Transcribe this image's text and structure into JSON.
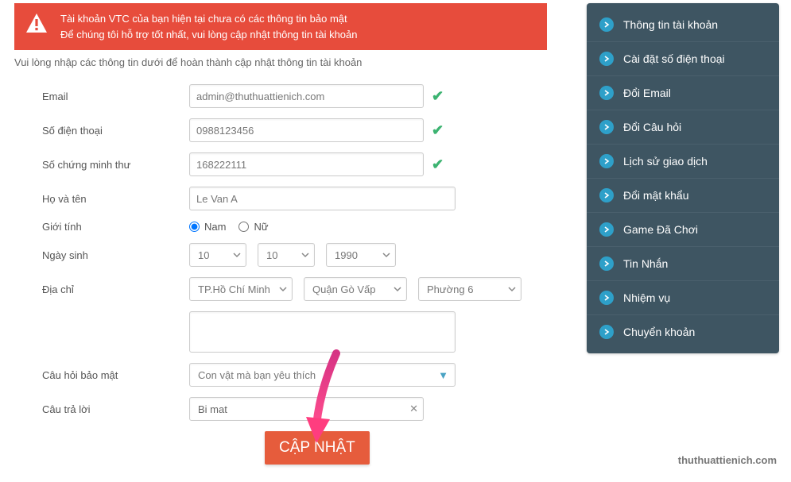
{
  "alert": {
    "line1": "Tài khoản VTC của bạn hiện tại chưa có các thông tin bảo mật",
    "line2": "Để chúng tôi hỗ trợ tốt nhất, vui lòng cập nhật thông tin tài khoản"
  },
  "instruction": "Vui lòng nhập các thông tin dưới để hoàn thành cập nhật thông tin tài khoản",
  "form": {
    "email_label": "Email",
    "email_value": "admin@thuthuattienich.com",
    "phone_label": "Số điện thoại",
    "phone_value": "0988123456",
    "id_label": "Số chứng minh thư",
    "id_value": "168222111",
    "name_label": "Họ và tên",
    "name_value": "Le Van A",
    "gender_label": "Giới tính",
    "gender_male": "Nam",
    "gender_female": "Nữ",
    "dob_label": "Ngày sinh",
    "dob_day": "10",
    "dob_month": "10",
    "dob_year": "1990",
    "addr_label": "Địa chỉ",
    "addr_city": "TP.Hồ Chí Minh",
    "addr_district": "Quận Gò Vấp",
    "addr_ward": "Phường 6",
    "question_label": "Câu hỏi bảo mật",
    "question_value": "Con vật mà bạn yêu thích",
    "answer_label": "Câu trả lời",
    "answer_value": "Bi mat",
    "submit": "CẬP NHẬT"
  },
  "sidebar": [
    "Thông tin tài khoản",
    "Cài đặt số điện thoại",
    "Đổi Email",
    "Đổi Câu hỏi",
    "Lịch sử giao dịch",
    "Đổi mật khẩu",
    "Game Đã Chơi",
    "Tin Nhắn",
    "Nhiệm vụ",
    "Chuyển khoản"
  ],
  "watermark": "thuthuattienich.com"
}
